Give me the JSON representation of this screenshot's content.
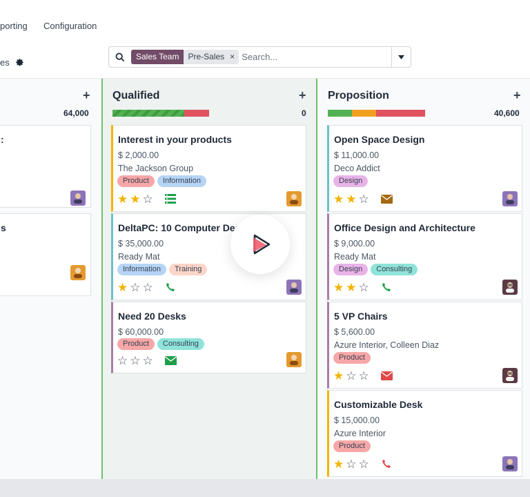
{
  "nav": {
    "menu": [
      "porting",
      "Configuration"
    ]
  },
  "breadcrumb": {
    "text": "es"
  },
  "search": {
    "facet_name": "Sales Team",
    "facet_value": "Pre-Sales",
    "facet_close": "×",
    "placeholder": "Search..."
  },
  "colors": {
    "green": "#52b152",
    "orange": "#f0a020",
    "red": "#e05260",
    "brand": "#714b67"
  },
  "columns": [
    {
      "name": "",
      "total": "64,000",
      "cards": [
        {
          "title": ":",
          "avatar": "av1"
        },
        {
          "title": "s",
          "avatar": "av2"
        }
      ]
    },
    {
      "name": "Qualified",
      "total": "0",
      "progress": {
        "green": 0.67,
        "red": 0.33
      },
      "cards": [
        {
          "title": "Interest in your products",
          "amount": "$ 2,000.00",
          "company": "The Jackson Group",
          "tags": [
            "Product",
            "Information"
          ],
          "stars": 2,
          "activity": "todo-list-icon"
        },
        {
          "title": "DeltaPC: 10 Computer Desks",
          "amount": "$ 35,000.00",
          "company": "Ready Mat",
          "tags": [
            "Information",
            "Training"
          ],
          "stars": 1,
          "activity": "phone-icon"
        },
        {
          "title": "Need 20 Desks",
          "amount": "$ 60,000.00",
          "company": "",
          "tags": [
            "Product",
            "Consulting"
          ],
          "stars": 0,
          "activity": "email-icon"
        }
      ]
    },
    {
      "name": "Proposition",
      "total": "40,600",
      "progress": {
        "green": 0.25,
        "orange": 0.25,
        "red": 0.5
      },
      "cards": [
        {
          "title": "Open Space Design",
          "amount": "$ 11,000.00",
          "company": "Deco Addict",
          "tags": [
            "Design"
          ],
          "stars": 2,
          "activity": "email-icon"
        },
        {
          "title": "Office Design and Architecture",
          "amount": "$ 9,000.00",
          "company": "Ready Mat",
          "tags": [
            "Design",
            "Consulting"
          ],
          "stars": 2,
          "activity": "phone-icon"
        },
        {
          "title": "5 VP Chairs",
          "amount": "$ 5,600.00",
          "company": "Azure Interior, Colleen Diaz",
          "tags": [
            "Product"
          ],
          "stars": 1,
          "activity": "email-icon"
        },
        {
          "title": "Customizable Desk",
          "amount": "$ 15,000.00",
          "company": "Azure Interior",
          "tags": [
            "Product"
          ],
          "stars": 1,
          "activity": "phone-icon"
        }
      ]
    }
  ]
}
